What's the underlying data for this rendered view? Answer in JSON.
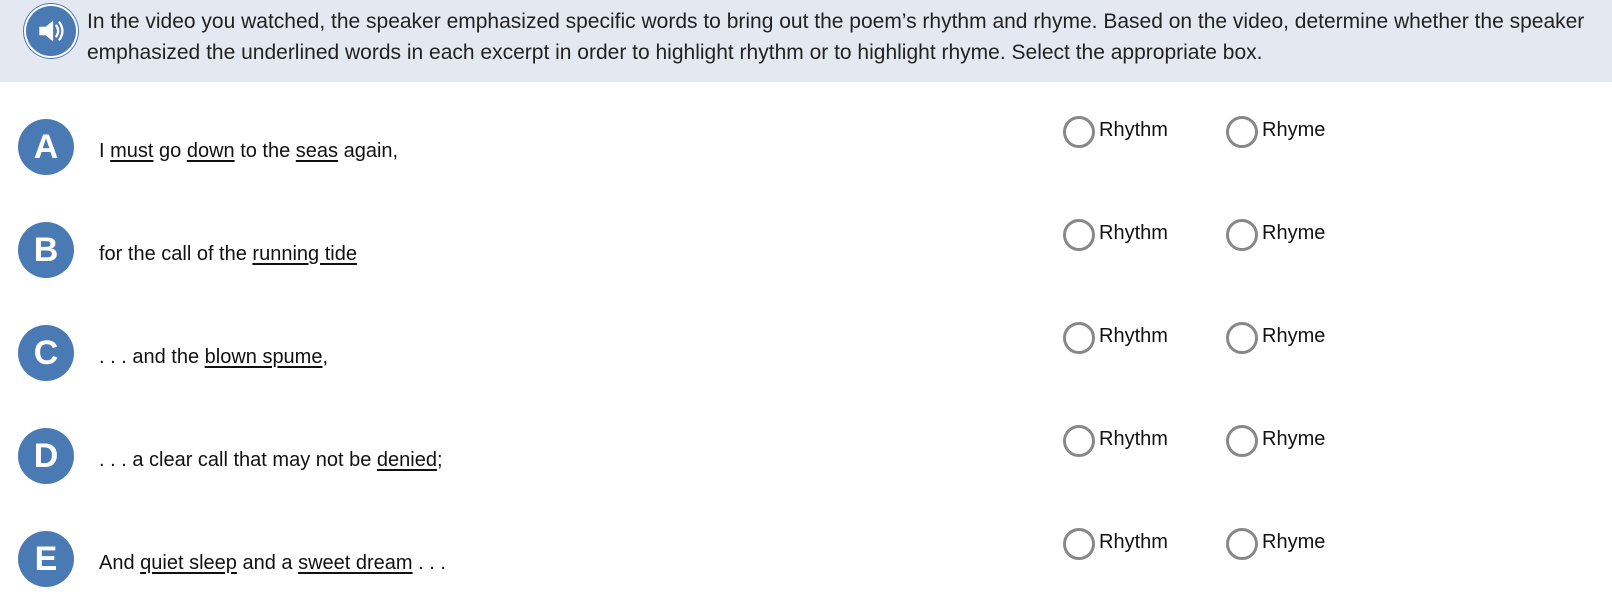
{
  "prompt": {
    "text": "In the video you watched, the speaker emphasized specific words to bring out the poem’s rhythm and rhyme. Based on the video, determine whether the speaker emphasized the underlined words in each excerpt in order to highlight rhythm or to highlight rhyme. Select the appropriate box.",
    "audio_icon": "speaker-volume-icon"
  },
  "colors": {
    "prompt_background": "#e4e9f1",
    "badge": "#4a7ab3",
    "radio_border": "#888888"
  },
  "options": {
    "rhythm_label": "Rhythm",
    "rhyme_label": "Rhyme"
  },
  "items": [
    {
      "letter": "A",
      "segments": [
        {
          "text": "I ",
          "underline": false
        },
        {
          "text": "must",
          "underline": true
        },
        {
          "text": " go ",
          "underline": false
        },
        {
          "text": "down",
          "underline": true
        },
        {
          "text": " to the ",
          "underline": false
        },
        {
          "text": "seas",
          "underline": true
        },
        {
          "text": " again,",
          "underline": false
        }
      ],
      "selected": null
    },
    {
      "letter": "B",
      "segments": [
        {
          "text": "for the call of the ",
          "underline": false
        },
        {
          "text": "running tide",
          "underline": true
        }
      ],
      "selected": null
    },
    {
      "letter": "C",
      "segments": [
        {
          "text": ". . . and the ",
          "underline": false
        },
        {
          "text": "blown spume",
          "underline": true
        },
        {
          "text": ",",
          "underline": false
        }
      ],
      "selected": null
    },
    {
      "letter": "D",
      "segments": [
        {
          "text": ". . . a clear call that may not be ",
          "underline": false
        },
        {
          "text": "denied",
          "underline": true
        },
        {
          "text": ";",
          "underline": false
        }
      ],
      "selected": null
    },
    {
      "letter": "E",
      "segments": [
        {
          "text": "And ",
          "underline": false
        },
        {
          "text": "quiet sleep",
          "underline": true
        },
        {
          "text": " and a ",
          "underline": false
        },
        {
          "text": "sweet dream",
          "underline": true
        },
        {
          "text": " . . .",
          "underline": false
        }
      ],
      "selected": null
    }
  ]
}
